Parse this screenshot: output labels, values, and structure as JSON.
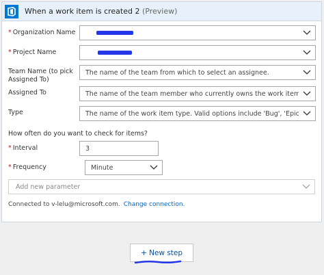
{
  "header": {
    "title": "When a work item is created 2",
    "preview": "(Preview)"
  },
  "fields": {
    "organization": {
      "label": "Organization Name",
      "required": "*",
      "value": ""
    },
    "project": {
      "label": "Project Name",
      "required": "*",
      "value": ""
    },
    "team": {
      "label": "Team Name (to pick Assigned To)",
      "placeholder": "The name of the team from which to select an assignee."
    },
    "assigned": {
      "label": "Assigned To",
      "placeholder": "The name of the team member who currently owns the work item."
    },
    "type": {
      "label": "Type",
      "placeholder": "The name of the work item type. Valid options include 'Bug', 'Epic', etc."
    }
  },
  "check": {
    "question": "How often do you want to check for items?",
    "interval": {
      "label": "Interval",
      "required": "*",
      "value": "3"
    },
    "frequency": {
      "label": "Frequency",
      "required": "*",
      "value": "Minute"
    }
  },
  "add_parameter": {
    "placeholder": "Add new parameter"
  },
  "connection": {
    "text": "Connected to v-lelu@microsoft.com.",
    "change_label": "Change connection."
  },
  "new_step": {
    "label": "+ New step"
  },
  "colors": {
    "accent": "#0078d4",
    "header_bg": "#e8f1fb",
    "required": "#a4262c",
    "link": "#0066c8",
    "redaction": "#2336e8"
  },
  "icons": [
    "azure-devops-logo-icon",
    "chevron-down-icon"
  ]
}
